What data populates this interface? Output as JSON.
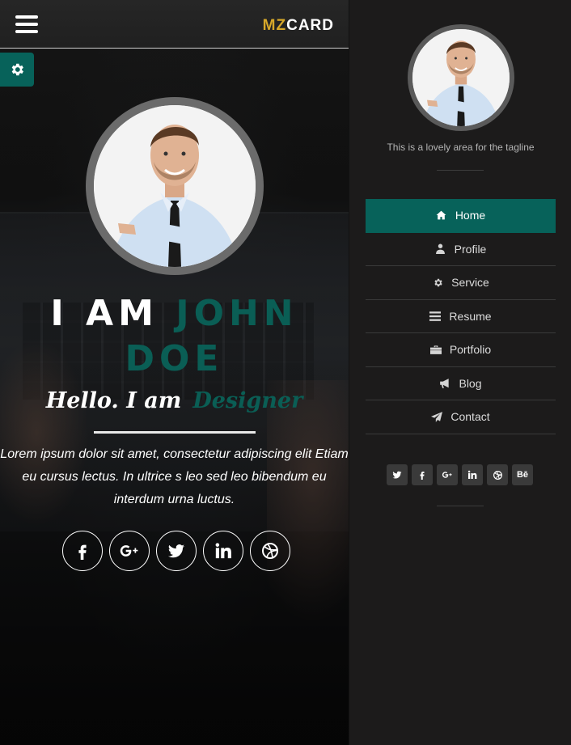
{
  "header": {
    "logo_part1": "MZ",
    "logo_part2": "CARD"
  },
  "hero": {
    "title_white": "I AM ",
    "title_green": "JOHN DOE",
    "hello_white": "Hello. I am",
    "hello_green": "Designer",
    "description": "Lorem ipsum dolor sit amet, consectetur adipiscing elit Etiam eu cursus lectus. In ultrice s leo sed leo bibendum eu interdum urna luctus.",
    "social": [
      "facebook-icon",
      "google-plus-icon",
      "twitter-icon",
      "linkedin-icon",
      "dribbble-icon"
    ]
  },
  "sidebar": {
    "tagline": "This is a lovely area for the tagline",
    "nav": [
      {
        "label": "Home",
        "icon": "home-icon",
        "active": true
      },
      {
        "label": "Profile",
        "icon": "user-icon",
        "active": false
      },
      {
        "label": "Service",
        "icon": "gear-icon",
        "active": false
      },
      {
        "label": "Resume",
        "icon": "list-icon",
        "active": false
      },
      {
        "label": "Portfolio",
        "icon": "briefcase-icon",
        "active": false
      },
      {
        "label": "Blog",
        "icon": "bullhorn-icon",
        "active": false
      },
      {
        "label": "Contact",
        "icon": "paper-plane-icon",
        "active": false
      }
    ],
    "social": [
      "twitter-icon",
      "facebook-icon",
      "google-plus-icon",
      "linkedin-icon",
      "dribbble-icon",
      "behance-icon"
    ],
    "behance_label": "Bē"
  },
  "colors": {
    "accent": "#07625a",
    "logo_gold": "#d7a82a",
    "sidebar_bg": "#1c1b1b"
  }
}
